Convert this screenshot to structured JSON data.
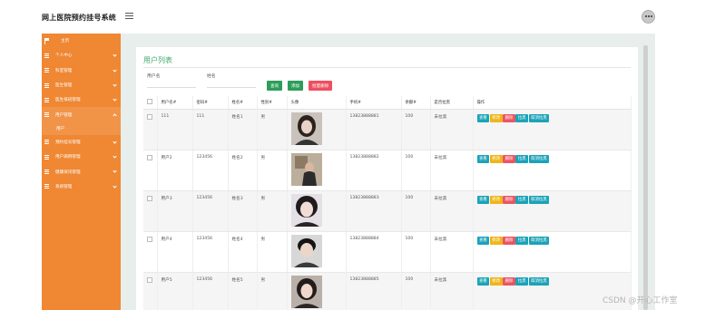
{
  "header": {
    "title": "网上医院预约挂号系统"
  },
  "sidebar": {
    "items": [
      {
        "label": "主页"
      },
      {
        "label": "个人中心"
      },
      {
        "label": "科室管理"
      },
      {
        "label": "医生管理"
      },
      {
        "label": "医生排班管理"
      },
      {
        "label": "用户管理"
      },
      {
        "label": "预约挂号管理"
      },
      {
        "label": "用户病例管理"
      },
      {
        "label": "健康资讯管理"
      },
      {
        "label": "系统管理"
      }
    ],
    "sub": {
      "label": "用户"
    }
  },
  "page": {
    "title": "用户列表",
    "search": {
      "username_label": "用户名",
      "name_label": "姓名",
      "username_value": "",
      "name_value": ""
    },
    "buttons": {
      "query": "查询",
      "add": "添加",
      "batch_delete": "批量删除"
    }
  },
  "table": {
    "columns": [
      "",
      "用户名#",
      "密码#",
      "姓名#",
      "性别#",
      "头像",
      "手机#",
      "余额#",
      "是否拉黑",
      "操作"
    ],
    "rows": [
      {
        "username": "111",
        "password": "111",
        "name": "姓名1",
        "gender": "男",
        "phone": "13823888881",
        "balance": "100",
        "blacklisted": "未拉黑"
      },
      {
        "username": "用户2",
        "password": "123456",
        "name": "姓名2",
        "gender": "男",
        "phone": "13823888882",
        "balance": "100",
        "blacklisted": "未拉黑"
      },
      {
        "username": "用户3",
        "password": "123456",
        "name": "姓名3",
        "gender": "男",
        "phone": "13823888883",
        "balance": "100",
        "blacklisted": "未拉黑"
      },
      {
        "username": "用户4",
        "password": "123456",
        "name": "姓名4",
        "gender": "男",
        "phone": "13823888884",
        "balance": "100",
        "blacklisted": "未拉黑"
      },
      {
        "username": "用户5",
        "password": "123456",
        "name": "姓名5",
        "gender": "男",
        "phone": "13823888885",
        "balance": "100",
        "blacklisted": "未拉黑"
      }
    ],
    "actions": {
      "view": "查看",
      "edit": "修改",
      "delete": "删除",
      "blacklist": "拉黑",
      "unblacklist": "取消拉黑"
    }
  },
  "watermark": "CSDN @开心工作室",
  "colors": {
    "sidebar": "#ef8733",
    "title_green": "#3fa96b",
    "btn_green": "#2d9d5a",
    "btn_red": "#ee4f5f",
    "op_teal": "#1aa3b8",
    "op_yellow": "#efb51a"
  }
}
